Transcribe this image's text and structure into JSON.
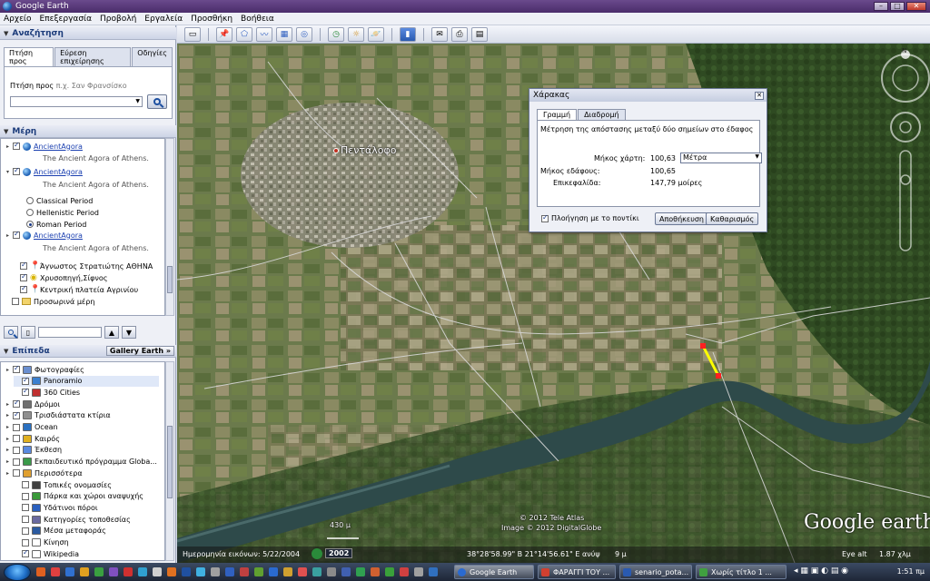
{
  "window": {
    "title": "Google Earth"
  },
  "menu": [
    "Αρχείο",
    "Επεξεργασία",
    "Προβολή",
    "Εργαλεία",
    "Προσθήκη",
    "Βοήθεια"
  ],
  "search": {
    "header": "Αναζήτηση",
    "tabs": [
      "Πτήση προς",
      "Εύρεση επιχείρησης",
      "Οδηγίες"
    ],
    "label": "Πτήση προς",
    "hint": "π.χ. Σαν Φρανσίσκο",
    "value": ""
  },
  "places": {
    "header": "Μέρη",
    "items": [
      {
        "type": "kml",
        "checked": true,
        "label": "AncientAgora",
        "desc": "The Ancient Agora of Athens."
      },
      {
        "type": "kml",
        "checked": true,
        "label": "AncientAgora",
        "desc": "The Ancient Agora of Athens."
      },
      {
        "type": "radio",
        "checked": false,
        "label": "Classical Period"
      },
      {
        "type": "radio",
        "checked": false,
        "label": "Hellenistic Period"
      },
      {
        "type": "radio",
        "checked": true,
        "label": "Roman Period"
      },
      {
        "type": "kml",
        "checked": true,
        "label": "AncientAgora",
        "desc": "The Ancient Agora of Athens."
      },
      {
        "type": "pin",
        "checked": true,
        "label": "Άγνωστος Στρατιώτης ΑΘΗΝΑ"
      },
      {
        "type": "pin",
        "checked": true,
        "label": "Χρυσοπηγή,Σίφνος"
      },
      {
        "type": "pin",
        "checked": true,
        "label": "Κεντρική πλατεία Αγρινίου"
      },
      {
        "type": "folder",
        "checked": false,
        "label": "Προσωρινά μέρη"
      }
    ]
  },
  "layers": {
    "header": "Επίπεδα",
    "gallery": "Gallery Earth",
    "items": [
      {
        "indent": 1,
        "checked": true,
        "label": "Φωτογραφίες",
        "color": "#6a8fd0"
      },
      {
        "indent": 2,
        "checked": true,
        "label": "Panoramio",
        "color": "#3a7fd0",
        "selected": true
      },
      {
        "indent": 2,
        "checked": true,
        "label": "360 Cities",
        "color": "#c03030"
      },
      {
        "indent": 1,
        "checked": true,
        "label": "Δρόμοι",
        "color": "#707070"
      },
      {
        "indent": 1,
        "checked": true,
        "label": "Τρισδιάστατα κτίρια",
        "color": "#909090"
      },
      {
        "indent": 1,
        "checked": false,
        "label": "Ocean",
        "color": "#2a70c0"
      },
      {
        "indent": 1,
        "checked": false,
        "label": "Καιρός",
        "color": "#e0b020"
      },
      {
        "indent": 1,
        "checked": false,
        "label": "Έκθεση",
        "color": "#5a8ae0"
      },
      {
        "indent": 1,
        "checked": false,
        "label": "Εκπαιδευτικό πρόγραμμα Globa...",
        "color": "#3a9a4a"
      },
      {
        "indent": 1,
        "checked": false,
        "label": "Περισσότερα",
        "color": "#e0a030"
      },
      {
        "indent": 2,
        "checked": false,
        "label": "Τοπικές ονομασίες",
        "color": "#404040"
      },
      {
        "indent": 2,
        "checked": false,
        "label": "Πάρκα και χώροι αναψυχής",
        "color": "#3a9a3a"
      },
      {
        "indent": 2,
        "checked": false,
        "label": "Υδάτινοι πόροι",
        "color": "#2a60c0"
      },
      {
        "indent": 2,
        "checked": false,
        "label": "Κατηγορίες τοποθεσίας",
        "color": "#6a6aa0"
      },
      {
        "indent": 2,
        "checked": false,
        "label": "Μέσα μεταφοράς",
        "color": "#2a5aa0"
      },
      {
        "indent": 2,
        "checked": false,
        "label": "Κίνηση",
        "color": "#ffffff"
      },
      {
        "indent": 2,
        "checked": true,
        "label": "Wikipedia",
        "color": "#ffffff"
      }
    ]
  },
  "map": {
    "place_label": "Πεντάλοφο",
    "copyright1": "© 2012 Tele Atlas",
    "copyright2": "Image © 2012 DigitalGlobe",
    "brand": "Google earth",
    "scale": "430 μ"
  },
  "ruler": {
    "title": "Χάρακας",
    "tabs": [
      "Γραμμή",
      "Διαδρομή"
    ],
    "description": "Μέτρηση της απόστασης μεταξύ δύο σημείων στο έδαφος",
    "map_length_label": "Μήκος χάρτη:",
    "map_length_value": "100,63",
    "unit": "Μέτρα",
    "ground_length_label": "Μήκος εδάφους:",
    "ground_length_value": "100,65",
    "heading_label": "Επικεφαλίδα:",
    "heading_value": "147,79 μοίρες",
    "mouse_nav": "Πλοήγηση με το ποντίκι",
    "save": "Αποθήκευση",
    "clear": "Καθαρισμός"
  },
  "status": {
    "imagery_date": "Ημερομηνία εικόνων: 5/22/2004",
    "year": "2002",
    "coords": "38°28'58.99\" Β  21°14'56.61\" Ε  ανύψ",
    "elev": "9 μ",
    "eye_alt_label": "Eye alt",
    "eye_alt": "1.87 χλμ"
  },
  "taskbar": {
    "tasks": [
      "Google Earth",
      "ΦΑΡΑΓΓΙ ΤΟΥ ...",
      "senario_pota...",
      "Χωρίς τίτλο 1 ..."
    ],
    "clock": "1:51 πμ"
  }
}
